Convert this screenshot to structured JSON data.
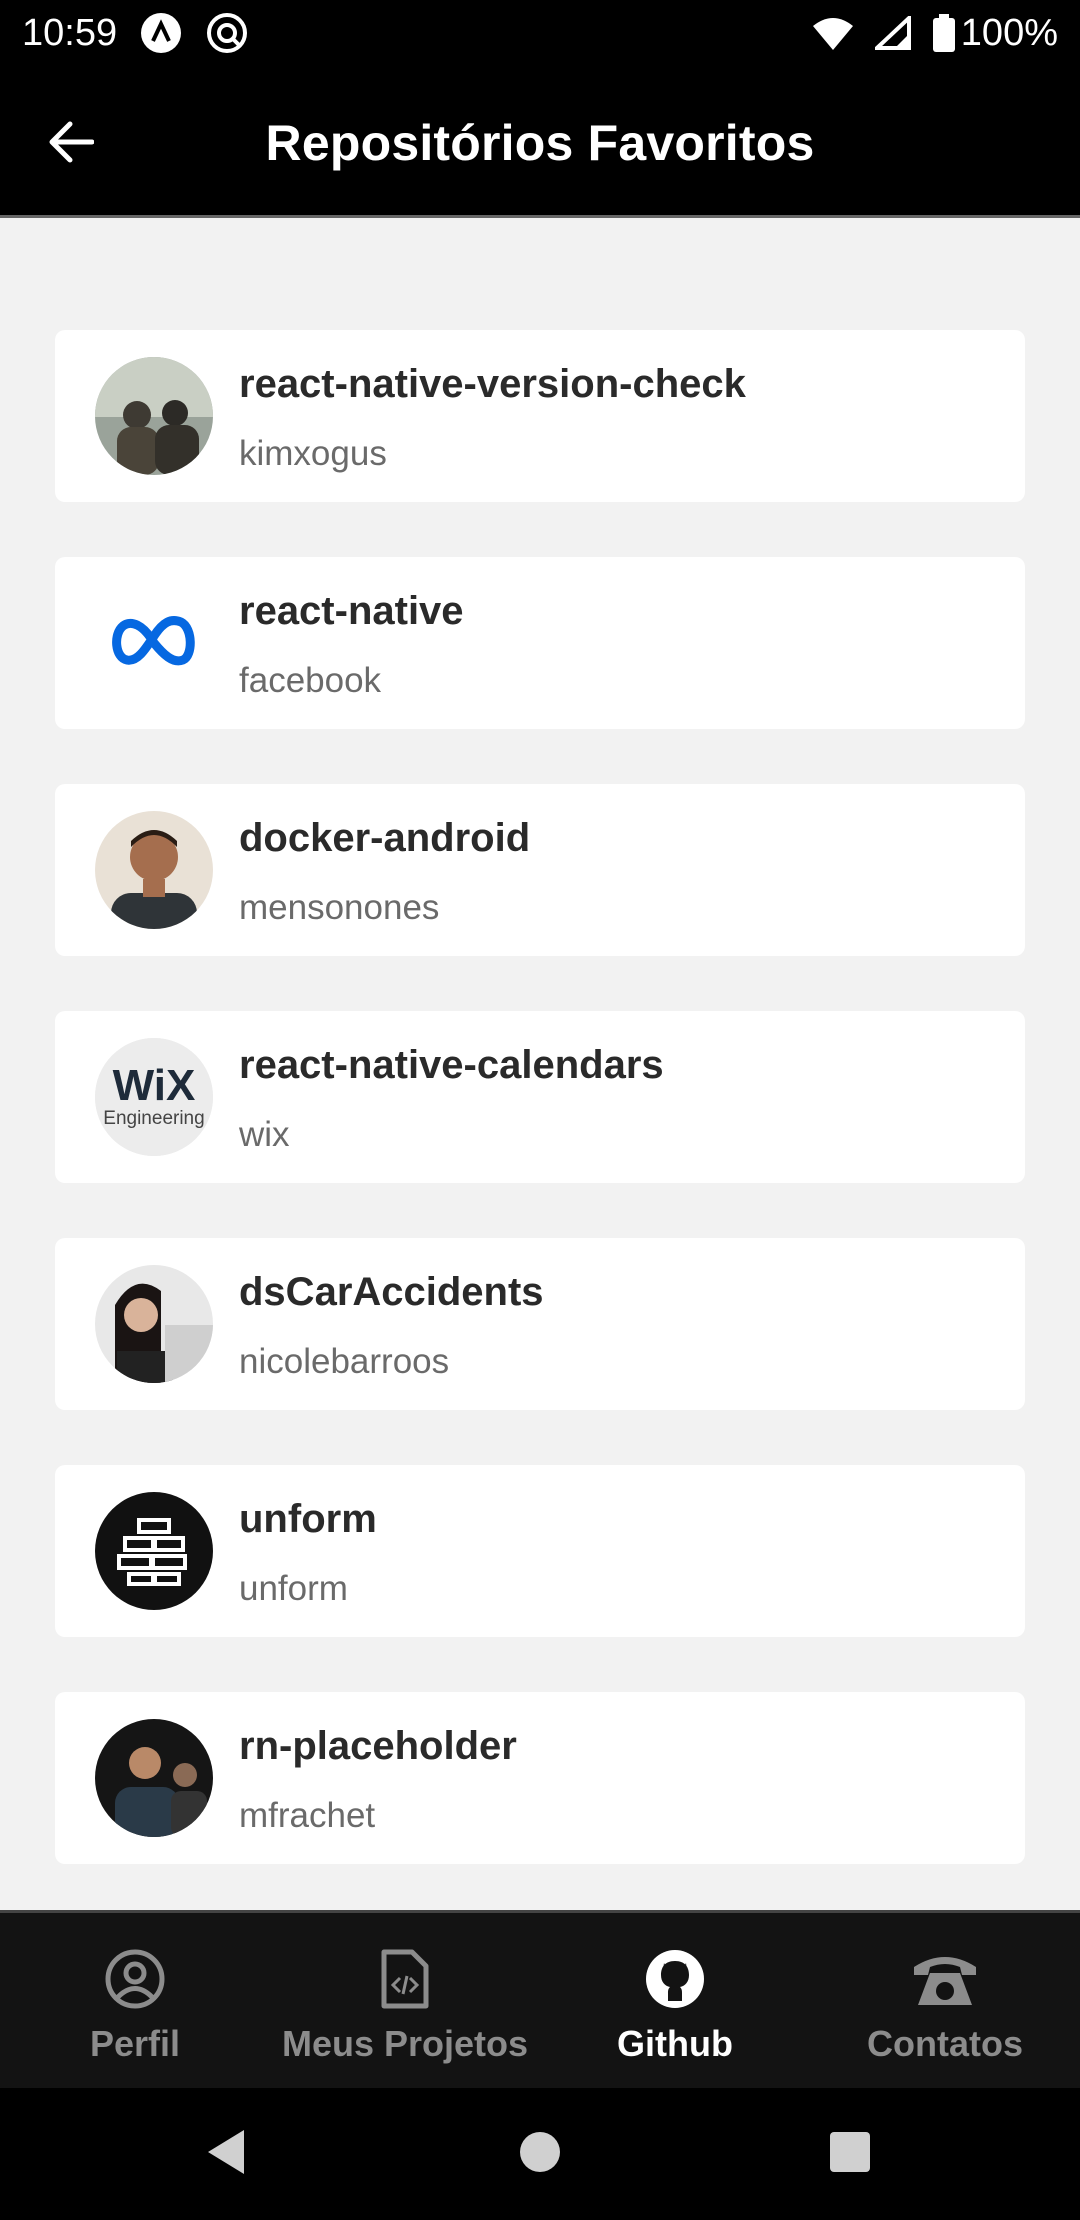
{
  "status_bar": {
    "time": "10:59",
    "battery": "100%",
    "icons": [
      "app-notification-icon",
      "app-notification-icon-2",
      "wifi-icon",
      "signal-icon",
      "battery-icon"
    ]
  },
  "header": {
    "title": "Repositórios Favoritos",
    "back_icon": "arrow-left-icon"
  },
  "repositories": [
    {
      "name": "react-native-version-check",
      "owner": "kimxogus"
    },
    {
      "name": "react-native",
      "owner": "facebook"
    },
    {
      "name": "docker-android",
      "owner": "mensonones"
    },
    {
      "name": "react-native-calendars",
      "owner": "wix"
    },
    {
      "name": "dsCarAccidents",
      "owner": "nicolebarroos"
    },
    {
      "name": "unform",
      "owner": "unform"
    },
    {
      "name": "rn-placeholder",
      "owner": "mfrachet"
    }
  ],
  "avatar_text": {
    "wix_logo": "WiX",
    "wix_sub": "Engineering"
  },
  "tabs": [
    {
      "label": "Perfil",
      "icon": "user-circle-icon",
      "active": false
    },
    {
      "label": "Meus Projetos",
      "icon": "code-file-icon",
      "active": false
    },
    {
      "label": "Github",
      "icon": "github-icon",
      "active": true
    },
    {
      "label": "Contatos",
      "icon": "phone-icon",
      "active": false
    }
  ],
  "colors": {
    "header_bg": "#000000",
    "content_bg": "#f2f2f2",
    "card_bg": "#ffffff",
    "tabbar_bg": "#131313",
    "tab_active": "#ffffff",
    "tab_inactive": "#8c8c8c",
    "meta_blue": "#0668e1"
  }
}
